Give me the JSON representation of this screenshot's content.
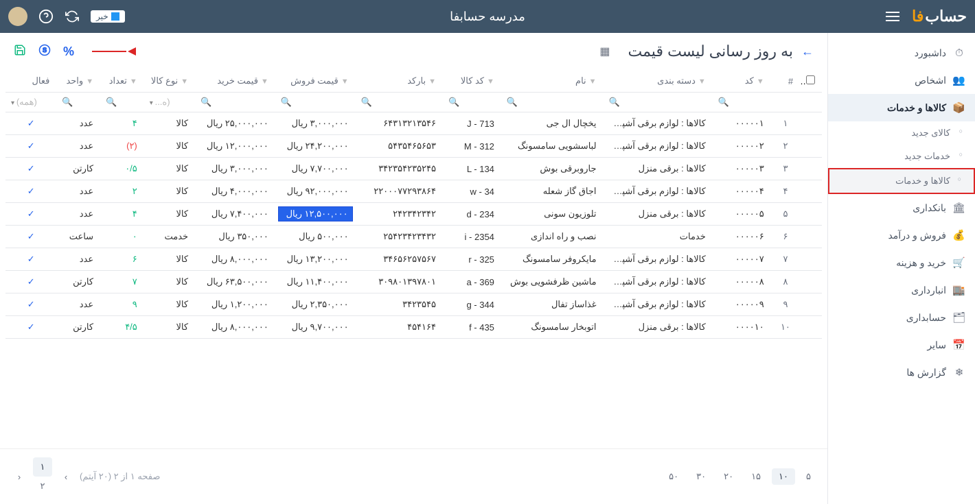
{
  "topbar": {
    "logo_text": "حساب",
    "logo_accent": "فا",
    "title": "مدرسه حسابفا",
    "toggle_label": "خیر"
  },
  "sidebar": {
    "items": [
      {
        "label": "داشبورد",
        "icon": "⏱"
      },
      {
        "label": "اشخاص",
        "icon": "👥"
      },
      {
        "label": "کالاها و خدمات",
        "icon": "📦",
        "active": true
      },
      {
        "label": "بانکداری",
        "icon": "🏛"
      },
      {
        "label": "فروش و درآمد",
        "icon": "💰"
      },
      {
        "label": "خرید و هزینه",
        "icon": "🛒"
      },
      {
        "label": "انبارداری",
        "icon": "🏬"
      },
      {
        "label": "حسابداری",
        "icon": "🗂"
      },
      {
        "label": "سایر",
        "icon": "📅"
      },
      {
        "label": "گزارش ها",
        "icon": "❄"
      }
    ],
    "subitems": [
      {
        "label": "کالای جدید"
      },
      {
        "label": "خدمات جدید"
      },
      {
        "label": "کالاها و خدمات",
        "highlighted": true
      }
    ]
  },
  "page": {
    "title": "به روز رسانی لیست قیمت",
    "percent_label": "%",
    "all_label": "(همه)",
    "alltype_label": "(ه..."
  },
  "columns": {
    "idx": "#",
    "code": "کد",
    "category": "دسته بندی",
    "name": "نام",
    "product_code": "کد کالا",
    "barcode": "بارکد",
    "sell_price": "قیمت فروش",
    "buy_price": "قیمت خرید",
    "type": "نوع کالا",
    "qty": "تعداد",
    "unit": "واحد",
    "active": "فعال"
  },
  "rows": [
    {
      "idx": "۱",
      "code": "۰۰۰۰۰۱",
      "category": "کالاها : لوازم برقی آشپز...",
      "name": "یخچال ال جی",
      "pcode": "J - 713",
      "barcode": "۶۴۳۱۳۲۱۳۵۴۶",
      "sell": "۳,۰۰۰,۰۰۰ ریال",
      "buy": "۲۵,۰۰۰,۰۰۰ ریال",
      "type": "کالا",
      "qty": "۴",
      "qtyclass": "qty-green",
      "unit": "عدد"
    },
    {
      "idx": "۲",
      "code": "۰۰۰۰۰۲",
      "category": "کالاها : لوازم برقی آشپز...",
      "name": "لباسشویی سامسونگ",
      "pcode": "M - 312",
      "barcode": "۵۴۳۵۴۶۵۶۵۳",
      "sell": "۲۴,۲۰۰,۰۰۰ ریال",
      "buy": "۱۲,۰۰۰,۰۰۰ ریال",
      "type": "کالا",
      "qty": "(۲)",
      "qtyclass": "qty-red",
      "unit": "عدد"
    },
    {
      "idx": "۳",
      "code": "۰۰۰۰۰۳",
      "category": "کالاها : برقی منزل",
      "name": "جاروبرقی بوش",
      "pcode": "L - 134",
      "barcode": "۳۴۲۳۵۴۲۳۵۲۴۵",
      "sell": "۷,۷۰۰,۰۰۰ ریال",
      "buy": "۳,۰۰۰,۰۰۰ ریال",
      "type": "کالا",
      "qty": "۰/۵",
      "qtyclass": "qty-green",
      "unit": "کارتن"
    },
    {
      "idx": "۴",
      "code": "۰۰۰۰۰۴",
      "category": "کالاها : لوازم برقی آشپز...",
      "name": "اجاق گاز شعله",
      "pcode": "w - 34",
      "barcode": "۲۲۰۰۰۷۷۲۹۳۸۶۴",
      "sell": "۹۲,۰۰۰,۰۰۰ ریال",
      "buy": "۴,۰۰۰,۰۰۰ ریال",
      "type": "کالا",
      "qty": "۲",
      "qtyclass": "qty-green",
      "unit": "عدد"
    },
    {
      "idx": "۵",
      "code": "۰۰۰۰۰۵",
      "category": "کالاها : برقی منزل",
      "name": "تلوزیون سونی",
      "pcode": "d - 234",
      "barcode": "۲۴۲۳۴۲۳۴۲",
      "sell": "۱۲,۵۰۰,۰۰۰ ریال",
      "buy": "۷,۴۰۰,۰۰۰ ریال",
      "type": "کالا",
      "qty": "۴",
      "qtyclass": "qty-green",
      "unit": "عدد",
      "editing": true
    },
    {
      "idx": "۶",
      "code": "۰۰۰۰۰۶",
      "category": "خدمات",
      "name": "نصب و راه اندازی",
      "pcode": "i - 2354",
      "barcode": "۲۵۴۲۳۴۲۳۴۳۲",
      "sell": "۵۰۰,۰۰۰ ریال",
      "buy": "۳۵۰,۰۰۰ ریال",
      "type": "خدمت",
      "qty": "۰",
      "qtyclass": "qty-green",
      "unit": "ساعت"
    },
    {
      "idx": "۷",
      "code": "۰۰۰۰۰۷",
      "category": "کالاها : لوازم برقی آشپز...",
      "name": "مایکروفر سامسونگ",
      "pcode": "r - 325",
      "barcode": "۳۴۶۵۶۲۵۷۵۶۷",
      "sell": "۱۳,۲۰۰,۰۰۰ ریال",
      "buy": "۸,۰۰۰,۰۰۰ ریال",
      "type": "کالا",
      "qty": "۶",
      "qtyclass": "qty-green",
      "unit": "عدد"
    },
    {
      "idx": "۸",
      "code": "۰۰۰۰۰۸",
      "category": "کالاها : لوازم برقی آشپز...",
      "name": "ماشین ظرفشویی بوش",
      "pcode": "a - 369",
      "barcode": "۳۰۹۸۰۱۳۹۷۸۰۱",
      "sell": "۱۱,۴۰۰,۰۰۰ ریال",
      "buy": "۶۳,۵۰۰,۰۰۰ ریال",
      "type": "کالا",
      "qty": "۷",
      "qtyclass": "qty-green",
      "unit": "کارتن"
    },
    {
      "idx": "۹",
      "code": "۰۰۰۰۰۹",
      "category": "کالاها : لوازم برقی آشپز...",
      "name": "غذاساز تفال",
      "pcode": "g - 344",
      "barcode": "۳۴۲۳۵۴۵",
      "sell": "۲,۳۵۰,۰۰۰ ریال",
      "buy": "۱,۲۰۰,۰۰۰ ریال",
      "type": "کالا",
      "qty": "۹",
      "qtyclass": "qty-green",
      "unit": "عدد"
    },
    {
      "idx": "۱۰",
      "code": "۰۰۰۰۱۰",
      "category": "کالاها : برقی منزل",
      "name": "اتوبخار سامسونگ",
      "pcode": "f - 435",
      "barcode": "۴۵۴۱۶۴",
      "sell": "۹,۷۰۰,۰۰۰ ریال",
      "buy": "۸,۰۰۰,۰۰۰ ریال",
      "type": "کالا",
      "qty": "۴/۵",
      "qtyclass": "qty-green",
      "unit": "کارتن"
    }
  ],
  "pagination": {
    "sizes": [
      "۵",
      "۱۰",
      "۱۵",
      "۲۰",
      "۳۰",
      "۵۰"
    ],
    "active_size": "۱۰",
    "info": "صفحه ۱ از ۲ (۲۰ آیتم)",
    "pages": [
      "۱",
      "۲"
    ],
    "active_page": "۱"
  }
}
